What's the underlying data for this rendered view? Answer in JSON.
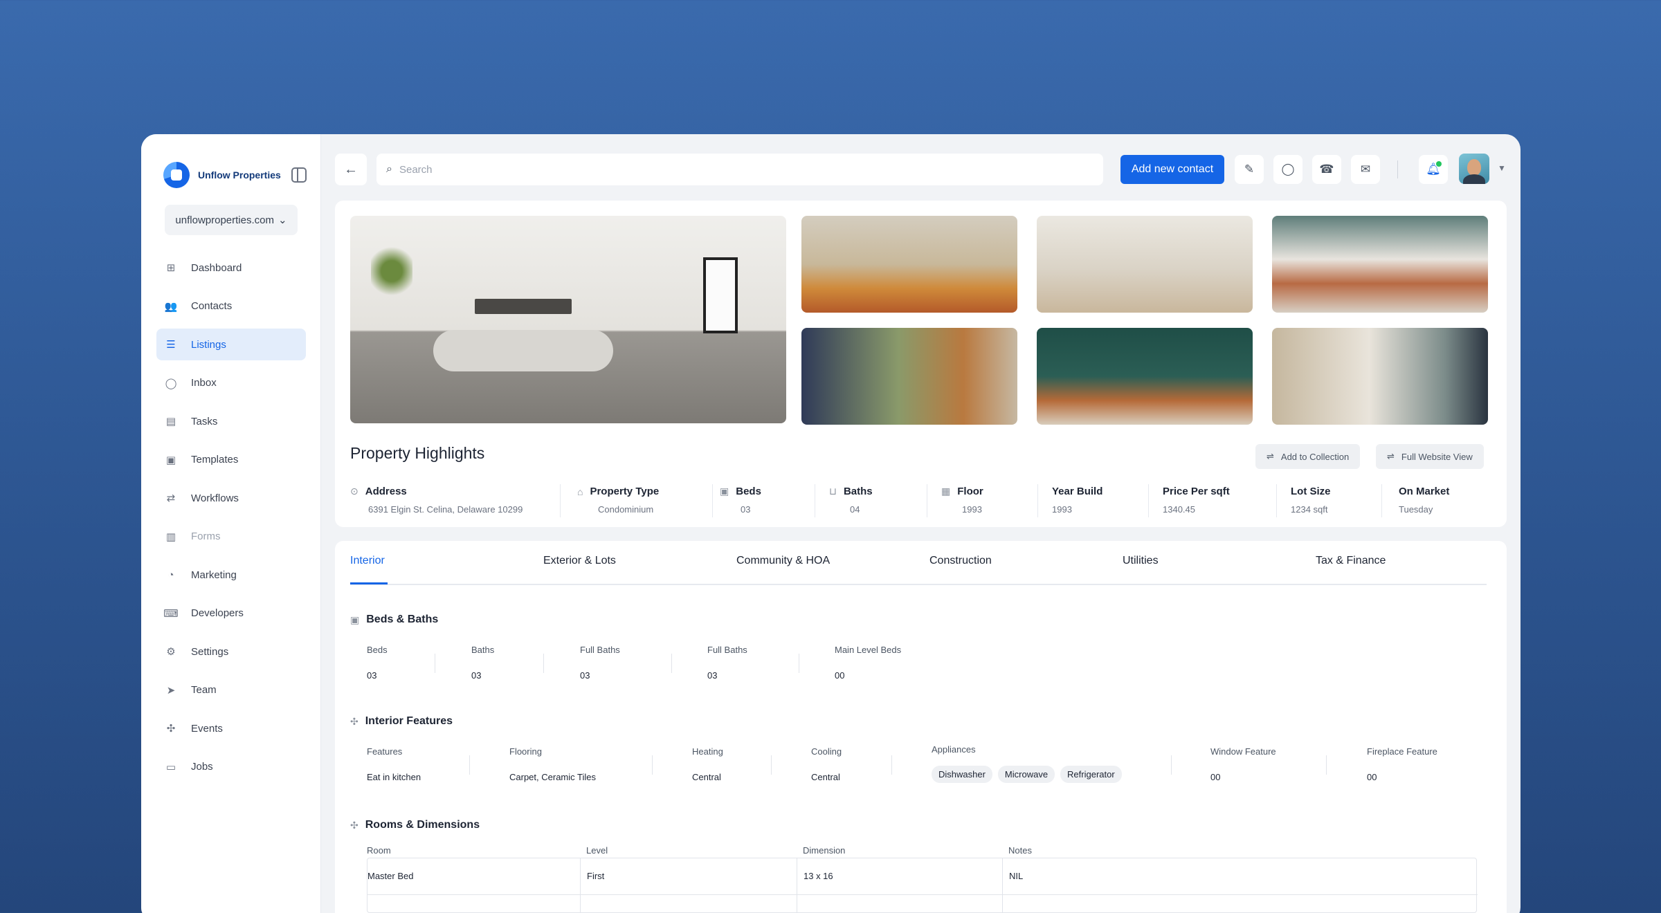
{
  "brand": {
    "name": "Unflow Properties"
  },
  "sidebar": {
    "domain": "unflowproperties.com",
    "items": [
      {
        "label": "Dashboard",
        "icon": "grid-icon"
      },
      {
        "label": "Contacts",
        "icon": "users-icon"
      },
      {
        "label": "Listings",
        "icon": "list-icon",
        "active": true
      },
      {
        "label": "Inbox",
        "icon": "chat-icon"
      },
      {
        "label": "Tasks",
        "icon": "document-icon"
      },
      {
        "label": "Templates",
        "icon": "template-icon"
      },
      {
        "label": "Workflows",
        "icon": "workflow-icon"
      },
      {
        "label": "Forms",
        "icon": "form-icon",
        "muted": true
      },
      {
        "label": "Marketing",
        "icon": "marketing-icon"
      },
      {
        "label": "Developers",
        "icon": "terminal-icon"
      },
      {
        "label": "Settings",
        "icon": "gear-icon"
      },
      {
        "label": "Team",
        "icon": "send-icon"
      },
      {
        "label": "Events",
        "icon": "target-icon"
      },
      {
        "label": "Jobs",
        "icon": "briefcase-icon"
      }
    ]
  },
  "topbar": {
    "search_placeholder": "Search",
    "add_button": "Add new contact"
  },
  "highlights": {
    "title": "Property Highlights",
    "add_collection": "Add to Collection",
    "full_view": "Full Website View",
    "attrs": [
      {
        "label": "Address",
        "value": "6391 Elgin St. Celina, Delaware 10299"
      },
      {
        "label": "Property Type",
        "value": "Condominium"
      },
      {
        "label": "Beds",
        "value": "03"
      },
      {
        "label": "Baths",
        "value": "04"
      },
      {
        "label": "Floor",
        "value": "1993"
      },
      {
        "label": "Year Build",
        "value": "1993"
      },
      {
        "label": "Price Per sqft",
        "value": "1340.45"
      },
      {
        "label": "Lot Size",
        "value": "1234 sqft"
      },
      {
        "label": "On Market",
        "value": "Tuesday"
      }
    ]
  },
  "tabs": [
    "Interior",
    "Exterior & Lots",
    "Community & HOA",
    "Construction",
    "Utilities",
    "Tax & Finance"
  ],
  "beds_baths": {
    "title": "Beds & Baths",
    "fields": [
      {
        "label": "Beds",
        "value": "03"
      },
      {
        "label": "Baths",
        "value": "03"
      },
      {
        "label": "Full Baths",
        "value": "03"
      },
      {
        "label": "Full Baths",
        "value": "03"
      },
      {
        "label": "Main Level Beds",
        "value": "00"
      }
    ]
  },
  "interior_features": {
    "title": "Interior Features",
    "features": {
      "label": "Features",
      "value": "Eat in kitchen"
    },
    "flooring": {
      "label": "Flooring",
      "value": "Carpet, Ceramic Tiles"
    },
    "heating": {
      "label": "Heating",
      "value": "Central"
    },
    "cooling": {
      "label": "Cooling",
      "value": "Central"
    },
    "appliances": {
      "label": "Appliances",
      "chips": [
        "Dishwasher",
        "Microwave",
        "Refrigerator"
      ]
    },
    "window": {
      "label": "Window Feature",
      "value": "00"
    },
    "fireplace": {
      "label": "Fireplace Feature",
      "value": "00"
    }
  },
  "rooms": {
    "title": "Rooms & Dimensions",
    "columns": [
      "Room",
      "Level",
      "Dimension",
      "Notes"
    ],
    "rows": [
      [
        "Master Bed",
        "First",
        "13 x 16",
        "NIL"
      ]
    ]
  }
}
